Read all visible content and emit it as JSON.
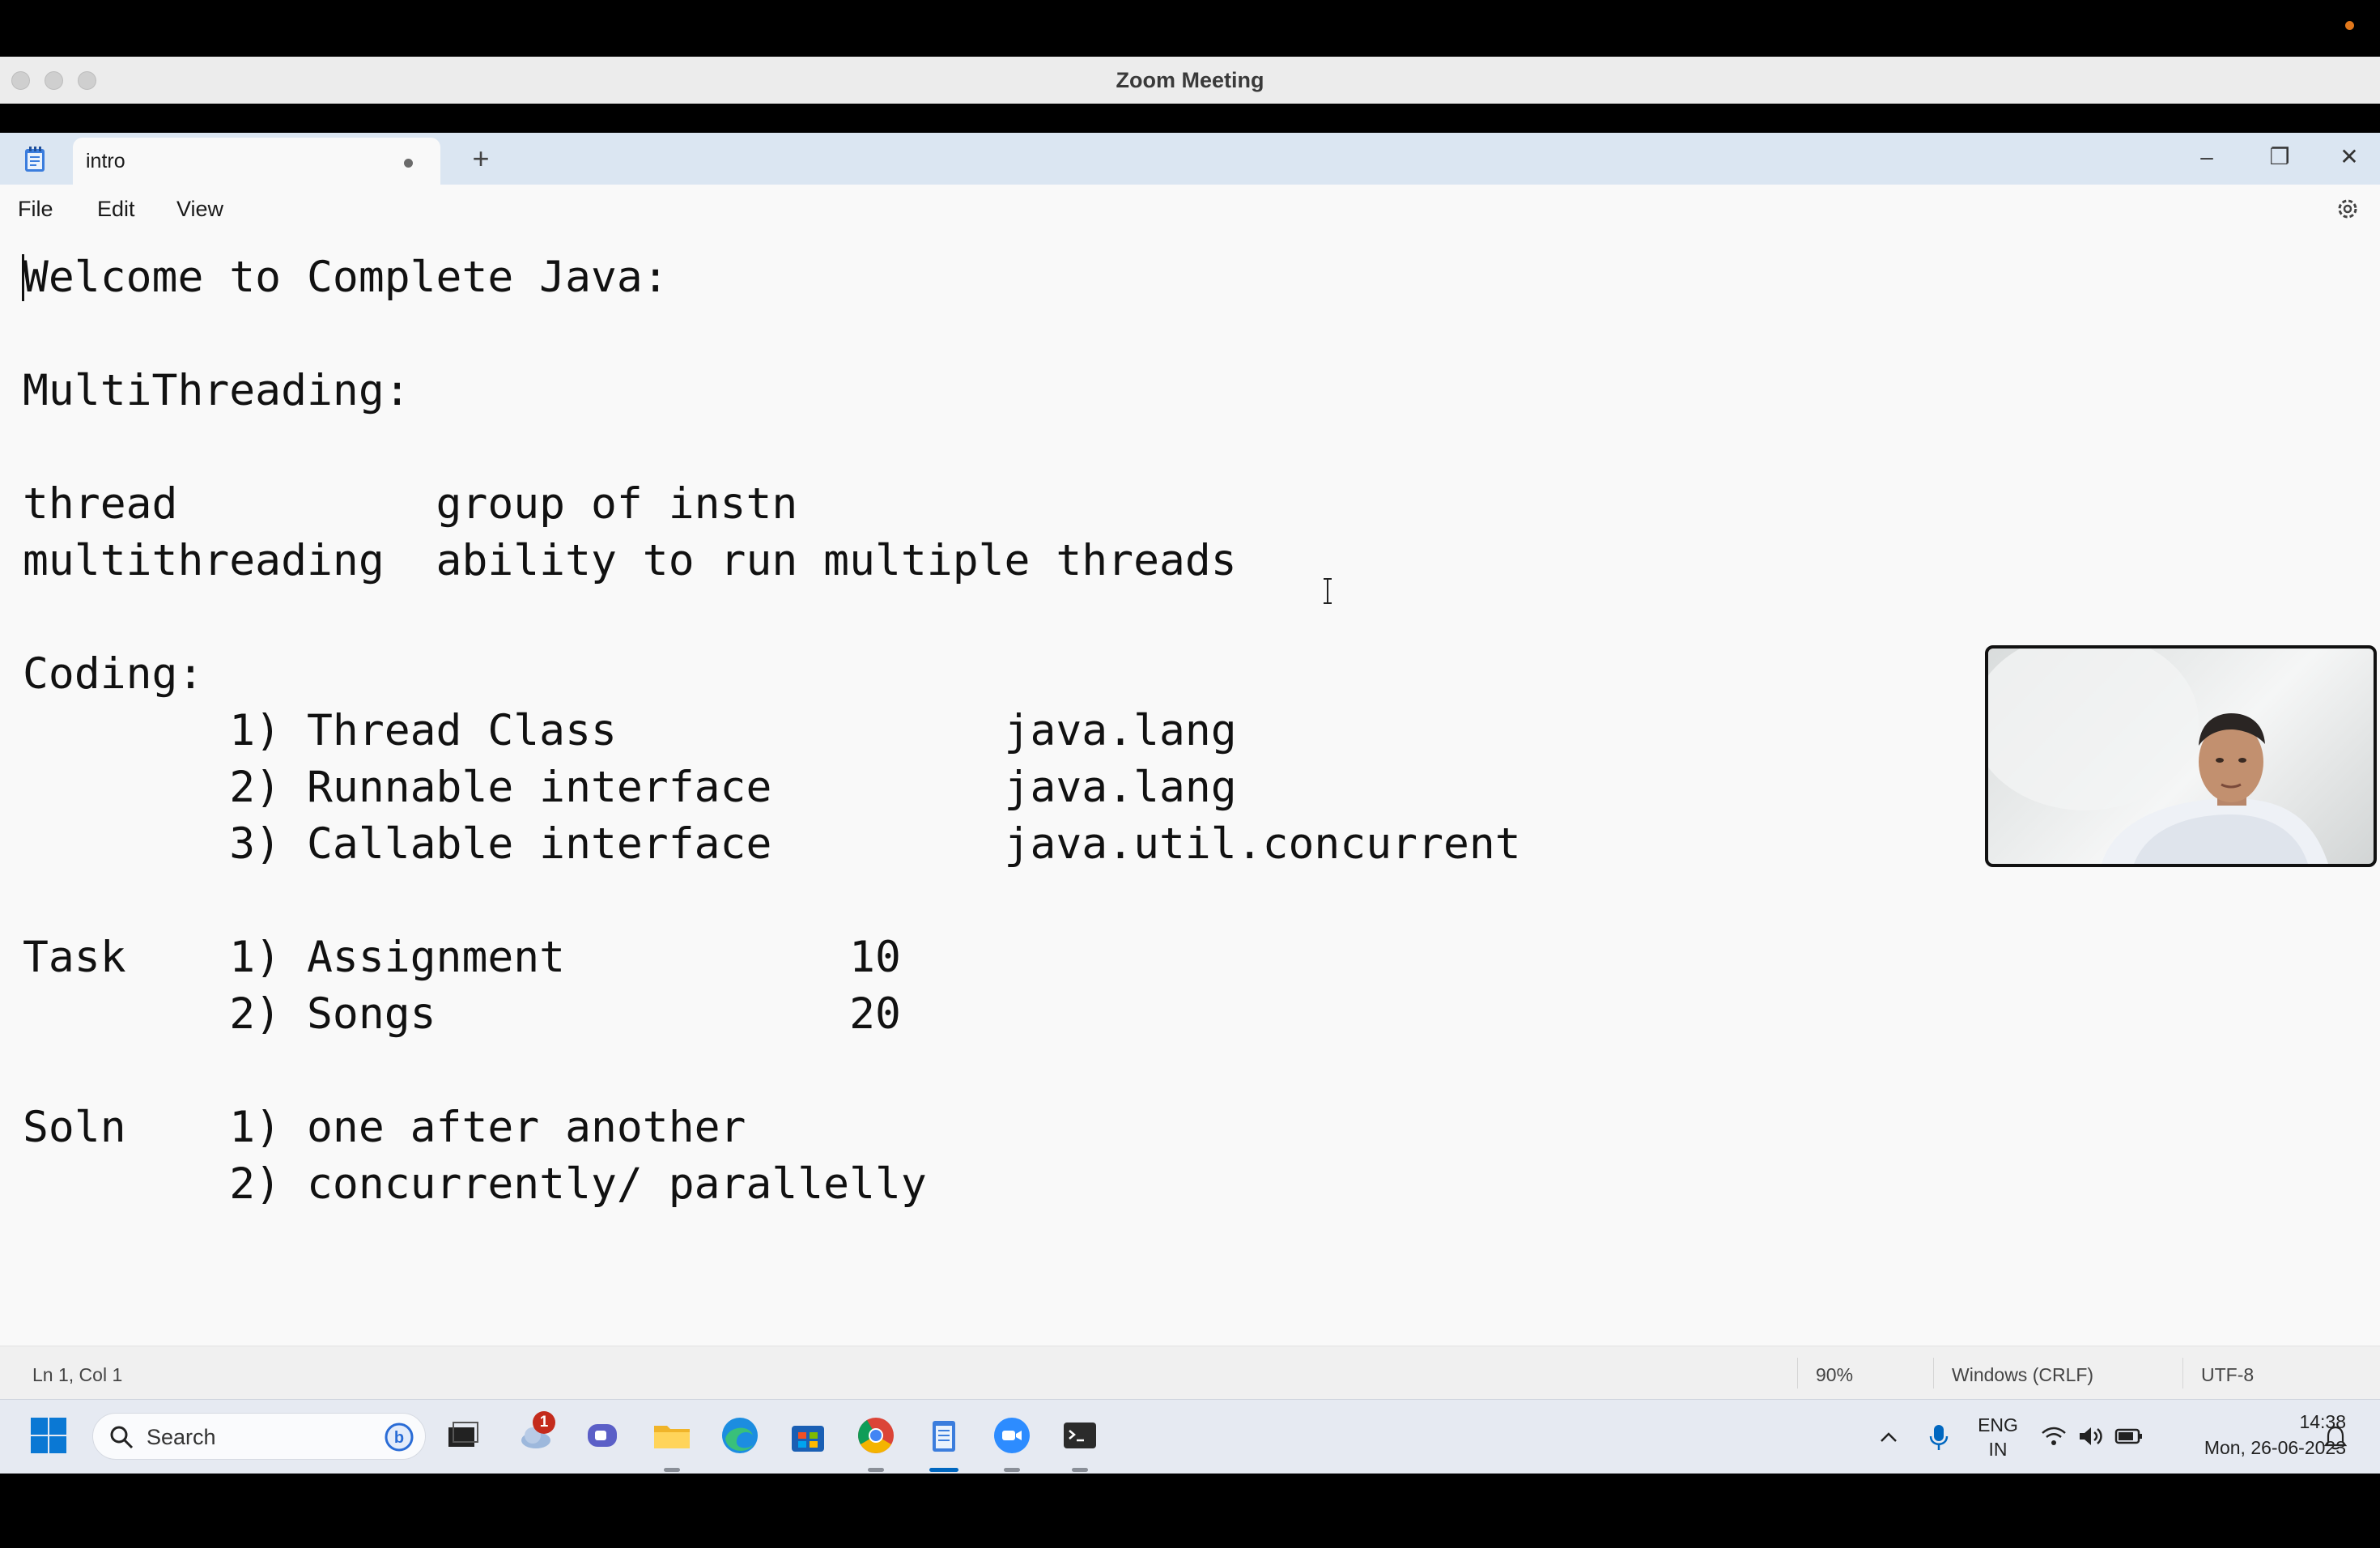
{
  "zoom": {
    "title": "Zoom Meeting"
  },
  "notepad": {
    "tab_title": "intro",
    "new_tab": "+",
    "menus": [
      "File",
      "Edit",
      "View"
    ],
    "window_controls": {
      "minimize": "–",
      "restore": "❐",
      "close": "✕"
    },
    "lines": [
      "Welcome to Complete Java:",
      "",
      "MultiThreading:",
      "",
      "thread          group of instn",
      "multithreading  ability to run multiple threads",
      "",
      "Coding:",
      "        1) Thread Class               java.lang",
      "        2) Runnable interface         java.lang",
      "        3) Callable interface         java.util.concurrent",
      "",
      "Task    1) Assignment           10",
      "        2) Songs                20",
      "",
      "Soln    1) one after another",
      "        2) concurrently/ parallelly"
    ],
    "status": {
      "position": "Ln 1, Col 1",
      "zoom": "90%",
      "line_ending": "Windows (CRLF)",
      "encoding": "UTF-8"
    }
  },
  "taskbar": {
    "search_label": "Search",
    "notification_badge": "1",
    "lang_top": "ENG",
    "lang_bottom": "IN",
    "time": "14:38",
    "date": "Mon, 26-06-2023"
  },
  "colors": {
    "accent": "#0067c0",
    "record": "#e0771b",
    "badge": "#c42b1c"
  }
}
